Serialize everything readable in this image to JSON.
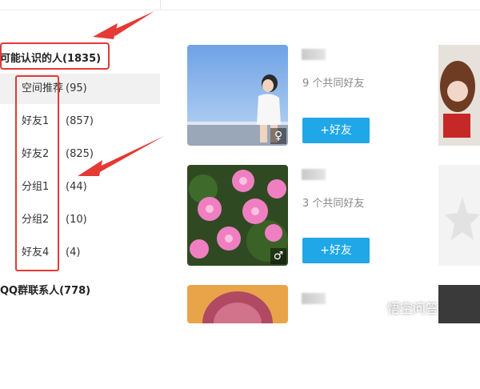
{
  "sidebar": {
    "group_header": "可能认识的人(1835)",
    "items": [
      {
        "label": "空间推荐",
        "count": "(95)"
      },
      {
        "label": "好友1",
        "count": "(857)"
      },
      {
        "label": "好友2",
        "count": "(825)"
      },
      {
        "label": "分组1",
        "count": "(44)"
      },
      {
        "label": "分组2",
        "count": "(10)"
      },
      {
        "label": "好友4",
        "count": "(4)"
      }
    ],
    "footer_group": "QQ群联系人(778)"
  },
  "cards": [
    {
      "mutual_friends": "9 个共同好友",
      "add_button": "+好友",
      "gender_icon": "female-icon",
      "gender_symbol": "♀"
    },
    {
      "mutual_friends": "3 个共同好友",
      "add_button": "+好友",
      "gender_icon": "male-icon",
      "gender_symbol": "♂"
    }
  ],
  "watermark": {
    "text": "悟空问答"
  },
  "colors": {
    "accent": "#1fa7e8",
    "annotation_red": "#e53935",
    "active_bg": "#f1f1f1"
  }
}
